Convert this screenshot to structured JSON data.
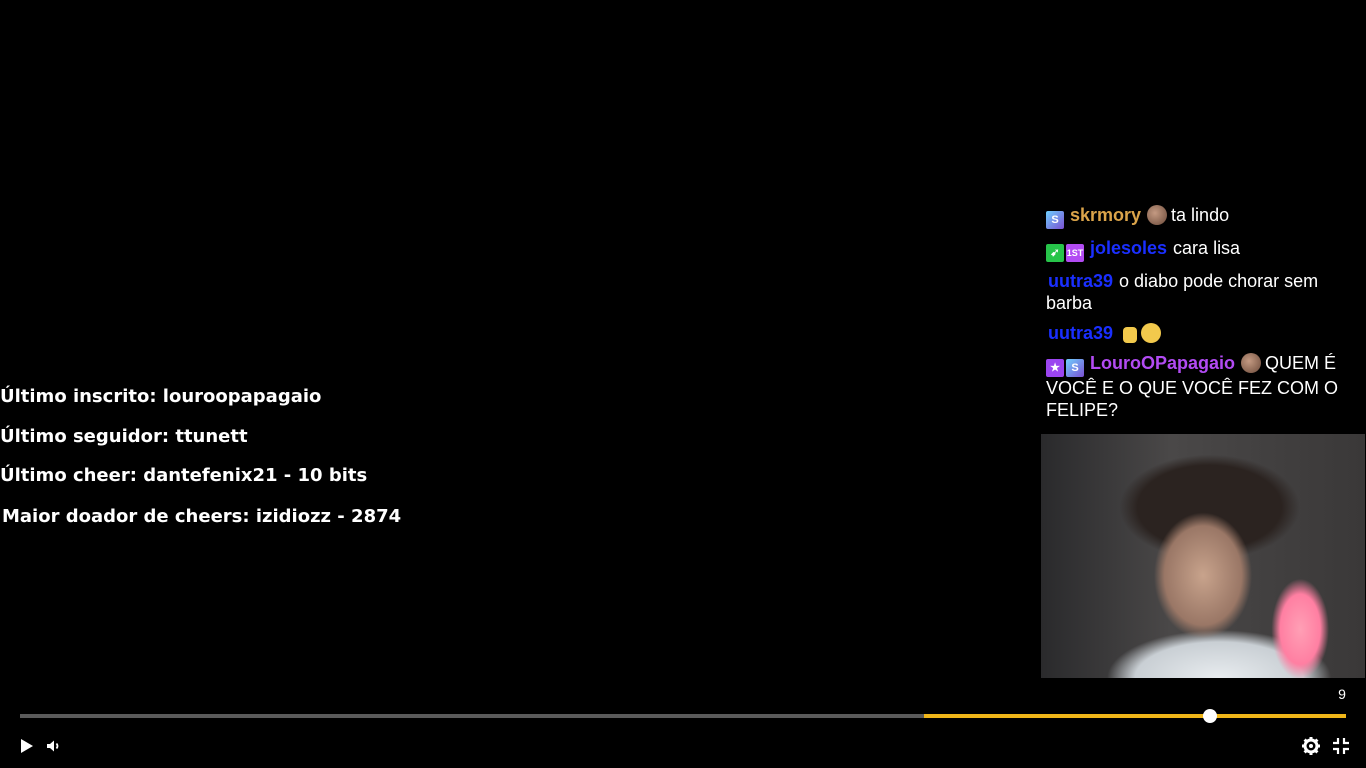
{
  "stats": {
    "last_sub": "Último inscrito: louroopapagaio",
    "last_follower": "Último seguidor: ttunett",
    "last_cheer": "Último cheer: dantefenix21 - 10 bits",
    "top_cheerer": "Maior doador de cheers: izidiozz - 2874"
  },
  "chat": {
    "messages": [
      {
        "badges": [
          "sub-badge-icon"
        ],
        "user": "skrmory",
        "user_color": "#dba44a",
        "emote": "face-emote-icon",
        "text": "ta lindo"
      },
      {
        "badges": [
          "green-badge-icon",
          "first-badge-icon"
        ],
        "user": "jolesoles",
        "user_color": "#1a2fff",
        "text": "cara lisa"
      },
      {
        "badges": [],
        "user": "uutra39",
        "user_color": "#1a2fff",
        "text": "o diabo pode chorar sem barba"
      },
      {
        "badges": [],
        "user": "uutra39",
        "user_color": "#1a2fff",
        "emotes": [
          "fist-emote-icon",
          "sad-emote-icon"
        ],
        "text": ""
      },
      {
        "badges": [
          "star-badge-icon",
          "sub-badge-icon"
        ],
        "user": "LouroOPapagaio",
        "user_color": "#b24bf3",
        "emote": "face-emote-icon",
        "text": "QUEM É VOCÊ E O QUE VOCÊ FEZ COM O FELIPE?"
      }
    ]
  },
  "player": {
    "time_tooltip": "9",
    "progress": 0.8975,
    "played_start": 0.6817,
    "accent": "#f0b619"
  }
}
